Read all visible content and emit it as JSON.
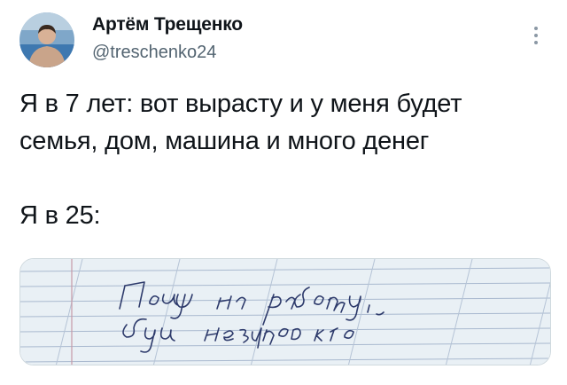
{
  "author": {
    "name": "Артём Трещенко",
    "handle": "@treschenko24"
  },
  "tweet": {
    "lines": [
      "Я в 7 лет: вот вырасту и у меня будет",
      "семья, дом, машина и много денег",
      "Я в 25:"
    ]
  },
  "image": {
    "handwritten_text": "Пойду на работу, буду незнаю кто"
  },
  "icons": {
    "more": "more-vertical-icon"
  },
  "colors": {
    "text": "#0f1419",
    "secondary": "#536471",
    "notebook_paper": "#e9f0f5",
    "ink": "#2d3a6b"
  }
}
